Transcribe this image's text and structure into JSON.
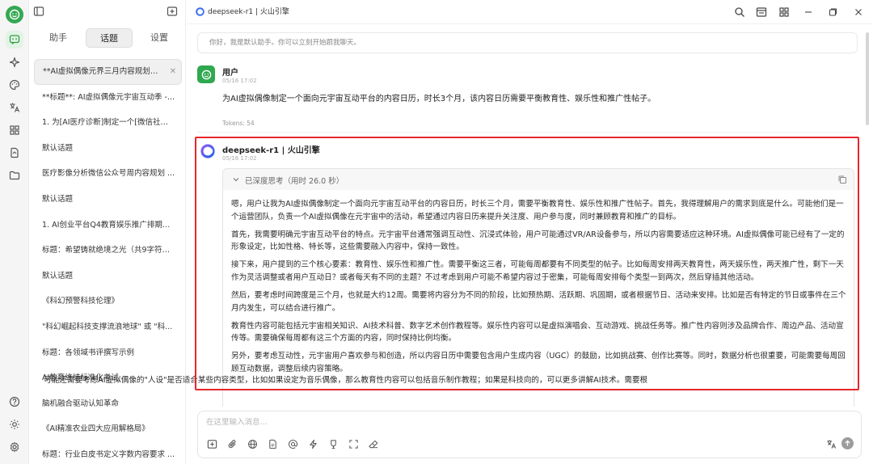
{
  "app": {
    "window_title": "deepseek-r1 | 火山引擎",
    "accent_color": "#34a853",
    "highlight_color": "#e8262c"
  },
  "sidebar": {
    "tabs": [
      {
        "label": "助手"
      },
      {
        "label": "话题",
        "active": true
      },
      {
        "label": "设置"
      }
    ],
    "topics": [
      {
        "label": "**AI虚拟偶像元界三月内容规划框架*..."
      },
      {
        "label": "**标题**: AI虚拟偶像元宇宙互动季 -..."
      },
      {
        "label": "1. 为[AI医疗诊断]制定一个[微信社群]..."
      },
      {
        "label": "默认话题"
      },
      {
        "label": "医疗影像分析微信公众号周内容规划 ..."
      },
      {
        "label": "默认话题"
      },
      {
        "label": "1. AI创业平台Q4教育娱乐推广排期规..."
      },
      {
        "label": "标题：希望铸就绝境之光（共9字符）..."
      },
      {
        "label": "默认话题"
      },
      {
        "label": "《科幻预警科技伦理》"
      },
      {
        "label": "\"科幻崛起科技支撑流浪地球\" 或 \"科..."
      },
      {
        "label": "标题：各领域书评撰写示例"
      },
      {
        "label": "AI教育终结标准化考试"
      },
      {
        "label": "脑机融合驱动认知革命"
      },
      {
        "label": "《AI精准农业四大应用解格局》"
      },
      {
        "label": "标题：行业白皮书定义字数内容要求 ..."
      }
    ]
  },
  "chat": {
    "greeting": "你好，我是默认助手。你可以立刻开始跟我聊天。",
    "user": {
      "name": "用户",
      "time": "05/16 17:02",
      "message": "为AI虚拟偶像制定一个面向元宇宙互动平台的内容日历，时长3个月，该内容日历需要平衡教育性、娱乐性和推广性帖子。",
      "tokens": "Tokens: 54"
    },
    "bot": {
      "name": "deepseek-r1 | 火山引擎",
      "time": "05/16 17:02",
      "thinking_label": "已深度思考（用时 26.0 秒）",
      "paragraphs": [
        "嗯，用户让我为AI虚拟偶像制定一个面向元宇宙互动平台的内容日历，时长三个月，需要平衡教育性、娱乐性和推广性帖子。首先，我得理解用户的需求到底是什么。可能他们是一个运营团队，负责一个AI虚拟偶像在元宇宙中的活动，希望通过内容日历来提升关注度、用户参与度，同时兼顾教育和推广的目标。",
        "首先，我需要明确元宇宙互动平台的特点。元宇宙平台通常强调互动性、沉浸式体验，用户可能通过VR/AR设备参与，所以内容需要适应这种环境。AI虚拟偶像可能已经有了一定的形象设定，比如性格、特长等，这些需要融入内容中，保持一致性。",
        "接下来，用户提到的三个核心要素：教育性、娱乐性和推广性。需要平衡这三者，可能每周都要有不同类型的帖子。比如每周安排两天教育性，两天娱乐性，两天推广性，剩下一天作为灵活调整或者用户互动日？或者每天有不同的主题？不过考虑到用户可能不希望内容过于密集，可能每周安排每个类型一到两次，然后穿插其他活动。",
        "然后，要考虑时间跨度是三个月，也就是大约12周。需要将内容分为不同的阶段，比如预热期、活跃期、巩固期，或者根据节日、活动来安排。比如是否有特定的节日或事件在三个月内发生，可以结合进行推广。",
        "教育性内容可能包括元宇宙相关知识、AI技术科普、数字艺术创作教程等。娱乐性内容可以是虚拟演唱会、互动游戏、挑战任务等。推广性内容则涉及品牌合作、周边产品、活动宣传等。需要确保每周都有这三个方面的内容，同时保持比例均衡。",
        "另外，要考虑互动性，元宇宙用户喜欢参与和创造，所以内容日历中需要包含用户生成内容（UGC）的鼓励，比如挑战赛、创作比赛等。同时，数据分析也很重要，可能需要每周回顾互动数据，调整后续内容策略。"
      ],
      "trailing_paragraph": "可能还需要考虑AI虚拟偶像的\"人设\"是否适合某些内容类型，比如如果设定为音乐偶像，那么教育性内容可以包括音乐制作教程；如果是科技向的，可以更多讲解AI技术。需要根"
    }
  },
  "composer": {
    "placeholder": "在这里输入消息..."
  },
  "icons": {
    "rail": [
      "avatar",
      "chat-icon",
      "sparkle-icon",
      "palette-icon",
      "translate-icon",
      "apps-icon",
      "files-icon",
      "folder-icon",
      "help-icon",
      "theme-icon",
      "settings-icon"
    ],
    "titlebar": [
      "search-icon",
      "layout-icon",
      "grid-icon",
      "minimize-icon",
      "maximize-icon",
      "close-icon"
    ],
    "composer": [
      "new-topic-icon",
      "attach-icon",
      "web-search-icon",
      "knowledge-icon",
      "mention-icon",
      "quick-phrase-icon",
      "clear-icon",
      "expand-icon",
      "eraser-icon",
      "translate-icon",
      "send-icon"
    ]
  }
}
